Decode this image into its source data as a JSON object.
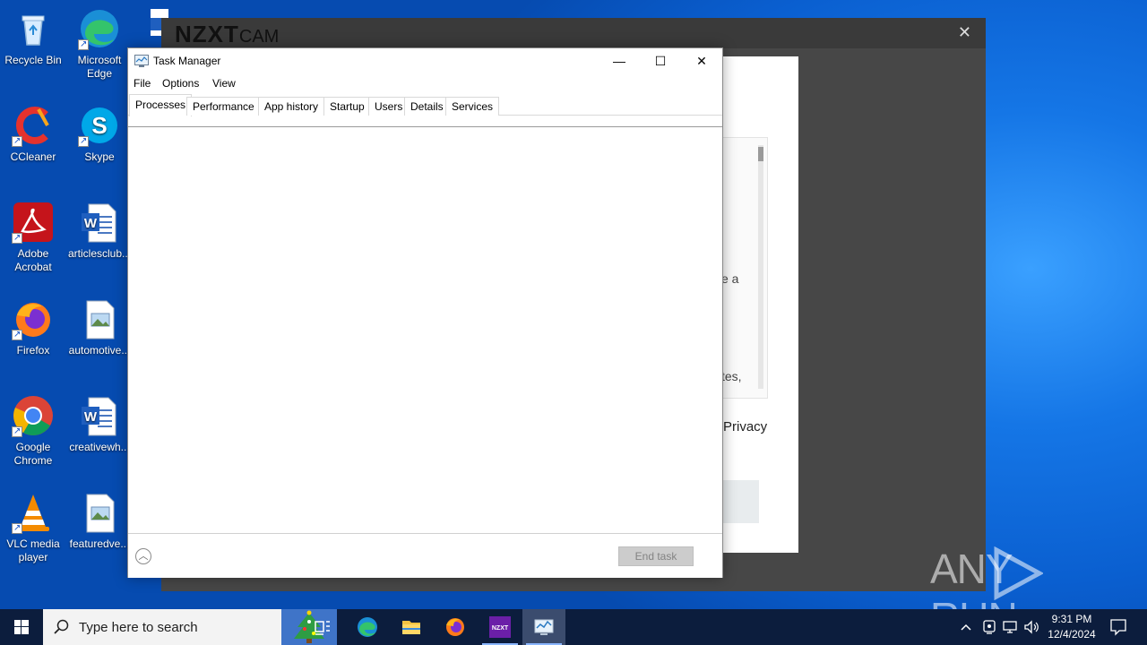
{
  "desktop": {
    "icons": [
      {
        "label": "Recycle Bin"
      },
      {
        "label": "Microsoft Edge"
      },
      {
        "label": "CCleaner"
      },
      {
        "label": "Skype"
      },
      {
        "label": "Adobe Acrobat"
      },
      {
        "label": "articlesclub..."
      },
      {
        "label": "Firefox"
      },
      {
        "label": "automotive..."
      },
      {
        "label": "Google Chrome"
      },
      {
        "label": "creativewh..."
      },
      {
        "label": "VLC media player"
      },
      {
        "label": "featuredve..."
      }
    ]
  },
  "nzxt": {
    "logo": "NZXT",
    "logo_suffix": "CAM",
    "close": "✕",
    "fragments": {
      "a": "e a",
      "b": "tes,",
      "privacy": "Privacy"
    }
  },
  "taskmanager": {
    "title": "Task Manager",
    "controls": {
      "minimize": "—",
      "maximize": "☐",
      "close": "✕"
    },
    "menu": [
      "File",
      "Options",
      "View"
    ],
    "tabs": [
      "Processes",
      "Performance",
      "App history",
      "Startup",
      "Users",
      "Details",
      "Services"
    ],
    "active_tab": "Processes",
    "footer": {
      "collapse": "︿",
      "end_task": "End task"
    }
  },
  "watermark": {
    "left": "ANY",
    "right": "RUN"
  },
  "taskbar": {
    "search_placeholder": "Type here to search",
    "clock_time": "9:31 PM",
    "clock_date": "12/4/2024",
    "nzxt_label": "NZXT"
  },
  "colors": {
    "desktop_blue": "#0a5fd0",
    "taskbar": "#0c1d3d",
    "nzxt_bg": "#474747",
    "end_task_disabled": "#cccccc"
  }
}
